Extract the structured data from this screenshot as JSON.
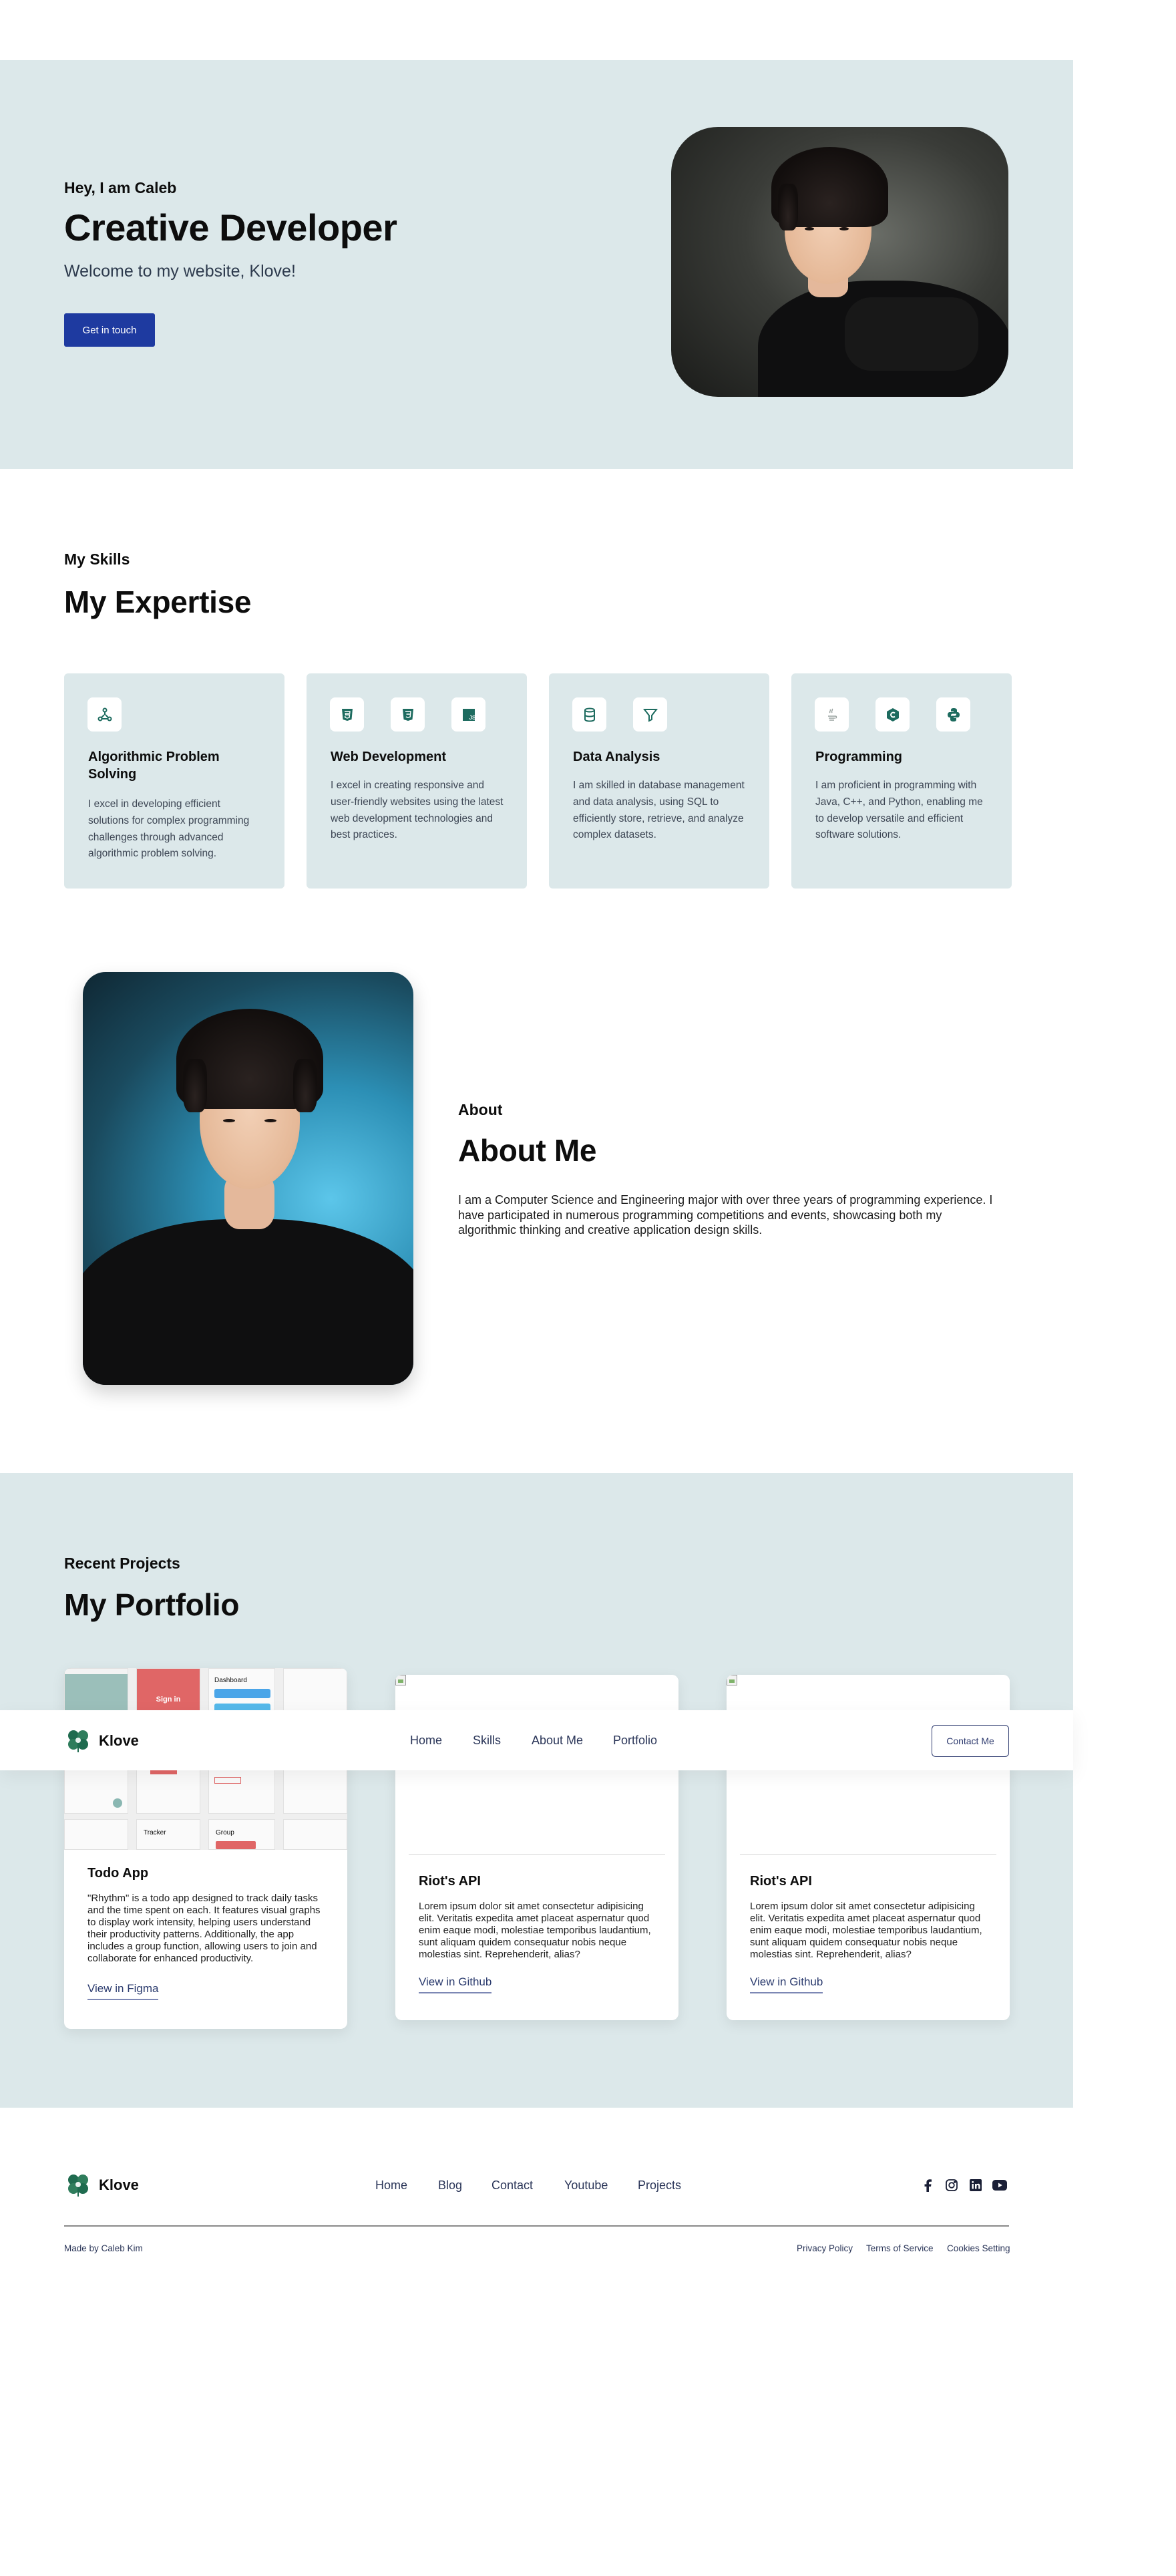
{
  "hero": {
    "eyebrow": "Hey, I am Caleb",
    "title": "Creative Developer",
    "subtitle": "Welcome to my website, Klove!",
    "cta_label": "Get in touch"
  },
  "skills": {
    "eyebrow": "My Skills",
    "title": "My Expertise",
    "cards": [
      {
        "title": "Algorithmic Problem Solving",
        "text": "I excel in developing efficient solutions for complex programming challenges through advanced algorithmic problem solving.",
        "icons": [
          "network-icon"
        ]
      },
      {
        "title": "Web Development",
        "text": "I excel in creating responsive and user-friendly websites using the latest web development technologies and best practices.",
        "icons": [
          "html5-icon",
          "css3-icon",
          "javascript-icon"
        ]
      },
      {
        "title": "Data Analysis",
        "text": "I am skilled in database management and data analysis, using SQL to efficiently store, retrieve, and analyze complex datasets.",
        "icons": [
          "database-icon",
          "filter-icon"
        ]
      },
      {
        "title": "Programming",
        "text": "I am proficient in programming with Java, C++, and Python, enabling me to develop versatile and efficient software solutions.",
        "icons": [
          "java-icon",
          "cplusplus-icon",
          "python-icon"
        ]
      }
    ]
  },
  "about": {
    "eyebrow": "About",
    "title": "About Me",
    "text": "I am a Computer Science and Engineering major with over three years of programming experience. I have participated in numerous programming competitions and events, showcasing both my algorithmic thinking and creative application design skills."
  },
  "portfolio": {
    "eyebrow": "Recent Projects",
    "title": "My Portfolio",
    "projects": [
      {
        "title": "Todo App",
        "text": "\"Rhythm\" is a todo app designed to track daily tasks and the time spent on each. It features visual graphs to display work intensity, helping users understand their productivity patterns. Additionally, the app includes a group function, allowing users to join and collaborate for enhanced productivity.",
        "link": "View in Figma"
      },
      {
        "title": "Riot's API",
        "text": "Lorem ipsum dolor sit amet consectetur adipisicing elit. Veritatis expedita amet placeat aspernatur quod enim eaque modi, molestiae temporibus laudantium, sunt aliquam quidem consequatur nobis neque molestias sint. Reprehenderit, alias?",
        "link": "View in Github"
      },
      {
        "title": "Riot's API",
        "text": "Lorem ipsum dolor sit amet consectetur adipisicing elit. Veritatis expedita amet placeat aspernatur quod enim eaque modi, molestiae temporibus laudantium, sunt aliquam quidem consequatur nobis neque molestias sint. Reprehenderit, alias?",
        "link": "View in Github"
      }
    ],
    "mockup_labels": {
      "signin": "Sign in",
      "dashboard": "Dashboard",
      "tracker": "Tracker",
      "group": "Group"
    }
  },
  "nav": {
    "brand": "Klove",
    "links": [
      "Home",
      "Skills",
      "About Me",
      "Portfolio"
    ],
    "contact_label": "Contact Me"
  },
  "footer": {
    "brand": "Klove",
    "links": [
      "Home",
      "Blog",
      "Contact",
      "Youtube",
      "Projects"
    ],
    "social_icons": [
      "facebook-icon",
      "instagram-icon",
      "linkedin-icon",
      "youtube-icon"
    ],
    "credit": "Made by Caleb Kim",
    "legal": [
      "Privacy Policy",
      "Terms of Service",
      "Cookies Setting"
    ]
  },
  "colors": {
    "section_bg": "#dce8ea",
    "primary_button": "#1e3aa0",
    "icon_teal": "#1d6b5f",
    "link_text": "#2a3558"
  }
}
